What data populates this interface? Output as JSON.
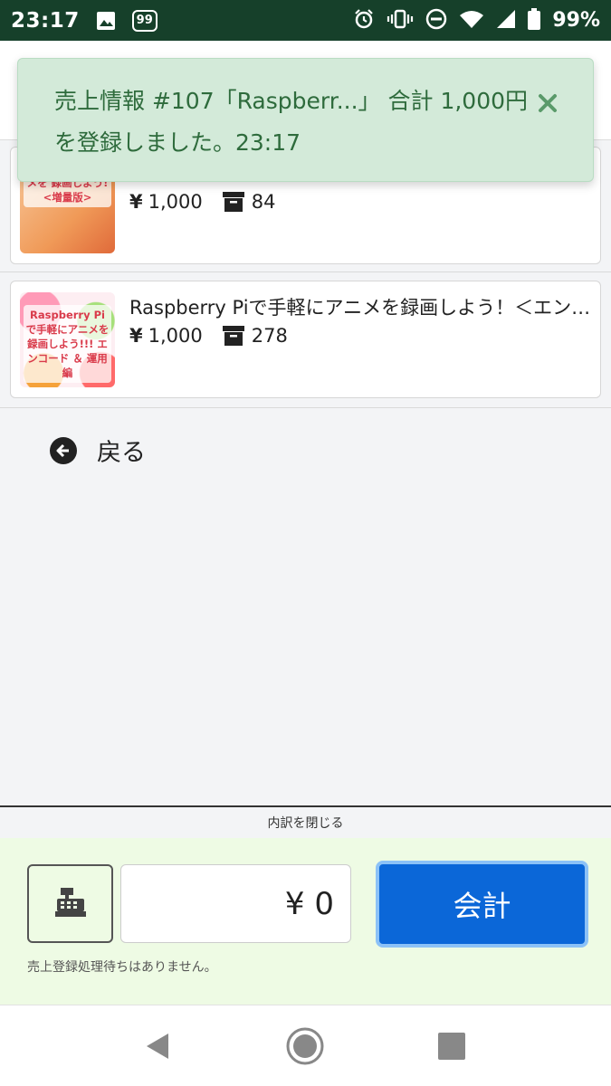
{
  "status_bar": {
    "time": "23:17",
    "notification_badge": "99",
    "battery_percent": "99%",
    "icons": [
      "image-icon",
      "badge-icon",
      "alarm-icon",
      "vibrate-icon",
      "dnd-icon",
      "wifi-icon",
      "signal-icon",
      "battery-icon"
    ]
  },
  "toast": {
    "message": "売上情報 #107「Raspberr...」 合計 1,000円 を登録しました。23:17",
    "color": "#2e6b3c",
    "background": "#d3ead9"
  },
  "products": [
    {
      "thumb_text": "で 手 軽 に アニメを 録画しよう! <増量版>",
      "price": "1,000",
      "currency": "¥",
      "stock": "84"
    },
    {
      "title": "Raspberry Piで手軽にアニメを録画しよう！＜エンコード＆運用編＞",
      "thumb_text": "Raspberry Pi で手軽にアニメを 録画しよう!!! エンコード ＆ 運用編",
      "price": "1,000",
      "currency": "¥",
      "stock": "278"
    }
  ],
  "back": {
    "label": "戻る"
  },
  "breakdown_toggle": {
    "label": "内訳を閉じる"
  },
  "register": {
    "amount": "¥ 0",
    "checkout_label": "会計",
    "queue_status": "売上登録処理待ちはありません。",
    "accent_color": "#0b67d8"
  }
}
